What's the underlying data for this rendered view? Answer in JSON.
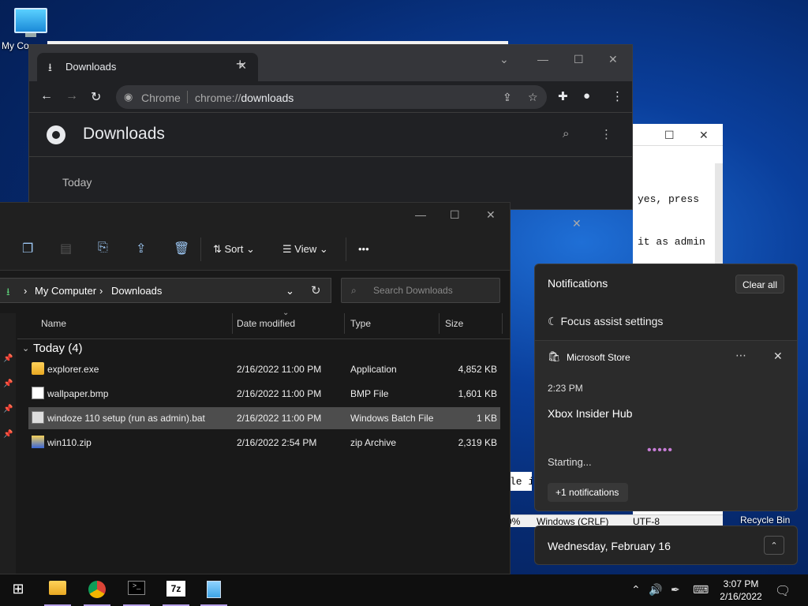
{
  "desktop": {
    "my_computer_label": "My Co",
    "recycle_bin_label": "Recycle Bin"
  },
  "notepad": {
    "line1": "yes, press",
    "line2": "it as admin",
    "partial_line": "le i",
    "status_zoom": "0%",
    "status_eol": "Windows (CRLF)",
    "status_encoding": "UTF-8"
  },
  "chrome": {
    "tab_title": "Downloads",
    "omnibox_label": "Chrome",
    "url_prefix": "chrome://",
    "url_path": "downloads",
    "page_title": "Downloads",
    "section_today": "Today"
  },
  "explorer": {
    "toolbar": {
      "sort_label": "Sort",
      "view_label": "View",
      "more_label": "•••"
    },
    "breadcrumb": [
      "My Computer",
      "Downloads"
    ],
    "search_placeholder": "Search Downloads",
    "columns": {
      "name": "Name",
      "date_modified": "Date modified",
      "type": "Type",
      "size": "Size"
    },
    "group_label": "Today (4)",
    "files": [
      {
        "name": "explorer.exe",
        "date": "2/16/2022 11:00 PM",
        "type": "Application",
        "size": "4,852 KB"
      },
      {
        "name": "wallpaper.bmp",
        "date": "2/16/2022 11:00 PM",
        "type": "BMP File",
        "size": "1,601 KB"
      },
      {
        "name": "windoze 110 setup (run as admin).bat",
        "date": "2/16/2022 11:00 PM",
        "type": "Windows Batch File",
        "size": "1 KB"
      },
      {
        "name": "win110.zip",
        "date": "2/16/2022 2:54 PM",
        "type": "zip Archive",
        "size": "2,319 KB"
      }
    ]
  },
  "notifications": {
    "header": "Notifications",
    "clear_all": "Clear all",
    "focus_assist": "Focus assist settings",
    "app_name": "Microsoft Store",
    "time": "2:23 PM",
    "title": "Xbox Insider Hub",
    "status": "Starting...",
    "more_notifications": "+1 notifications",
    "date": "Wednesday, February 16"
  },
  "taskbar": {
    "time": "3:07 PM",
    "date": "2/16/2022",
    "sevenzip_label": "7z"
  },
  "colors": {
    "accent_purple": "#c77dd6",
    "selection_gray": "#4d4d4d"
  }
}
